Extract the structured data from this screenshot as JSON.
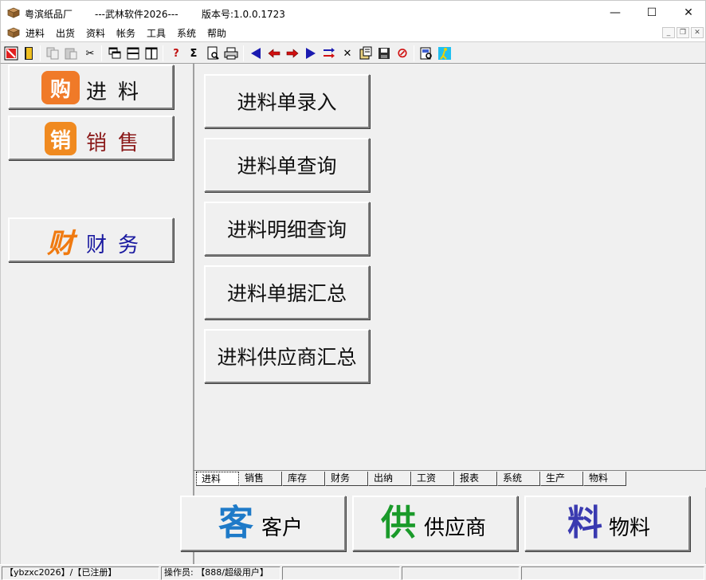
{
  "titlebar": {
    "company": "粤滨纸品厂",
    "software": "---武林软件2026---",
    "version": "版本号:1.0.0.1723",
    "minimize": "—",
    "maximize": "☐",
    "close": "✕"
  },
  "menu": {
    "items": [
      "进料",
      "出货",
      "资料",
      "帐务",
      "工具",
      "系统",
      "帮助"
    ],
    "mdi_minimize": "_",
    "mdi_restore": "❐",
    "mdi_close": "✕"
  },
  "toolbar": {
    "icons": [
      "exit-icon",
      "door-icon",
      "copy-icon",
      "paste-icon",
      "cut-icon",
      "window-cascade-icon",
      "window-tile-horizontal-icon",
      "window-tile-vertical-icon",
      "query-icon",
      "sum-icon",
      "preview-icon",
      "print-icon",
      "first-record-icon",
      "prev-record-icon",
      "next-record-icon",
      "last-record-icon",
      "insert-icon",
      "delete-icon",
      "edit-icon",
      "save-icon",
      "cancel-icon",
      "find-icon",
      "run-icon"
    ],
    "glyphs": {
      "sum": "Σ",
      "query": "?",
      "delete": "✕",
      "cut": "✂",
      "cancel": "⊘"
    }
  },
  "modules": {
    "purchase": {
      "badge": "购",
      "label": "进料",
      "badge_color": "#f07a28",
      "label_color": "#111111"
    },
    "sales": {
      "badge": "销",
      "label": "销售",
      "badge_color": "#f08a20",
      "label_color": "#8b1a1a"
    },
    "finance": {
      "badge": "财",
      "label": "财务",
      "badge_color": "#f07a10",
      "label_color": "#1a1aa0"
    }
  },
  "functions": [
    "进料单录入",
    "进料单查询",
    "进料明细查询",
    "进料单据汇总",
    "进料供应商汇总"
  ],
  "tabs": [
    "进料",
    "销售",
    "库存",
    "财务",
    "出纳",
    "工资",
    "报表",
    "系统",
    "生产",
    "物料"
  ],
  "active_tab": "进料",
  "bottom_buttons": {
    "customer": {
      "glyph": "客",
      "label": "客户",
      "glyph_color": "#1e7ac8"
    },
    "supplier": {
      "glyph": "供",
      "label": "供应商",
      "glyph_color": "#1a9a2a"
    },
    "material": {
      "glyph": "料",
      "label": "物料",
      "glyph_color": "#3a3ab0"
    }
  },
  "status": {
    "user": "【ybzxc2026】/【已注册】",
    "operator": "操作员: 【888/超级用户】"
  }
}
